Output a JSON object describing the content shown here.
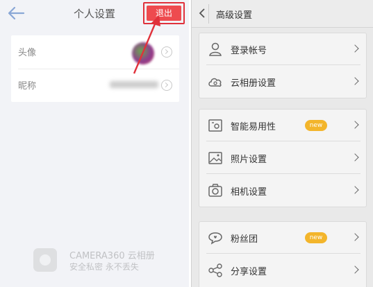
{
  "left": {
    "header": {
      "title": "个人设置",
      "logout_label": "退出"
    },
    "rows": [
      {
        "label": "头像"
      },
      {
        "label": "昵称"
      }
    ],
    "watermark": {
      "line1": "CAMERA360 云相册",
      "line2": "安全私密  永不丢失"
    }
  },
  "right": {
    "header": {
      "title": "高级设置"
    },
    "groups": [
      {
        "items": [
          {
            "label": "登录帐号",
            "icon": "user-icon"
          },
          {
            "label": "云相册设置",
            "icon": "cloud-icon"
          }
        ]
      },
      {
        "items": [
          {
            "label": "智能易用性",
            "icon": "smart-gear-icon",
            "badge": "new"
          },
          {
            "label": "照片设置",
            "icon": "image-icon"
          },
          {
            "label": "相机设置",
            "icon": "camera-icon"
          }
        ]
      },
      {
        "items": [
          {
            "label": "粉丝团",
            "icon": "chat-heart-icon",
            "badge": "new"
          },
          {
            "label": "分享设置",
            "icon": "share-icon"
          }
        ]
      }
    ]
  },
  "colors": {
    "logout": "#ee4b4f",
    "badge": "#f3b52b",
    "highlight": "#e0313b"
  }
}
